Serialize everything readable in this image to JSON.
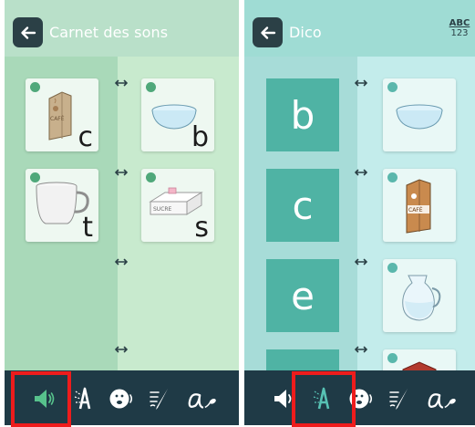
{
  "left_screen": {
    "header": {
      "title": "Carnet des sons",
      "back_icon": "arrow-left-icon"
    },
    "cards": [
      {
        "picture": "coffee-pack",
        "label": "CAFÉ",
        "letter": "c"
      },
      {
        "picture": "bowl",
        "letter": "b"
      },
      {
        "picture": "mug",
        "letter": "t"
      },
      {
        "picture": "sugar-box",
        "label": "SUCRE",
        "letter": "s"
      }
    ],
    "toolbar": {
      "tools": [
        "speaker-icon",
        "letters-icon",
        "speaking-face-icon",
        "writing-icon",
        "cursive-a-icon"
      ],
      "active_tool": "speaker-icon"
    },
    "colors": {
      "header": "#b9e0c9",
      "accent": "#57c28c",
      "toolbar": "#1f3a46",
      "highlight": "#ee1c1c"
    }
  },
  "right_screen": {
    "header": {
      "title": "Dico",
      "back_icon": "arrow-left-icon",
      "keyboard_toggle": {
        "top": "ABC",
        "bottom": "123"
      }
    },
    "rows": [
      {
        "letter": "b",
        "picture": "bowl"
      },
      {
        "letter": "c",
        "picture": "coffee-pack",
        "label": "CAFÉ"
      },
      {
        "letter": "e",
        "picture": "water-jug"
      },
      {
        "letter": "",
        "picture": "red-pack"
      }
    ],
    "toolbar": {
      "tools": [
        "speaker-icon",
        "letters-icon",
        "speaking-face-icon",
        "writing-icon",
        "cursive-a-icon"
      ],
      "active_tool": "letters-icon"
    },
    "colors": {
      "header": "#9fdcd4",
      "accent": "#4fb3a4",
      "toolbar": "#1f3a46",
      "highlight": "#ee1c1c"
    }
  }
}
